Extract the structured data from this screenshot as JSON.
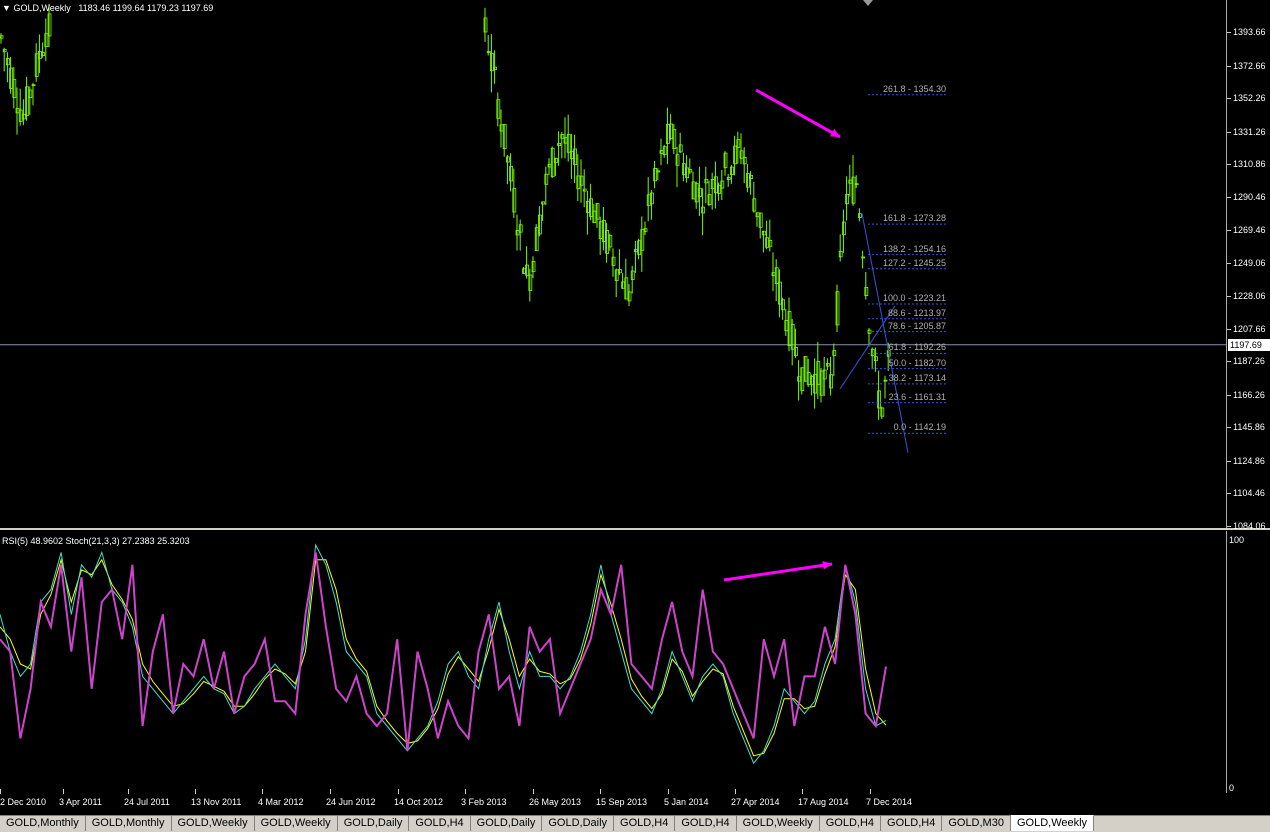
{
  "window": {
    "symbol_header": "GOLD,Weekly",
    "ohlc": "1183.46 1199.64 1179.23 1197.69",
    "current_price": "1197.69",
    "indicator_header": "RSI(5) 48.9602 Stoch(21,3,3) 27.2383 25.3203"
  },
  "price_axis": [
    "1393.66",
    "1372.66",
    "1352.26",
    "1331.26",
    "1310.86",
    "1290.46",
    "1269.46",
    "1249.06",
    "1228.06",
    "1207.66",
    "1187.26",
    "1166.26",
    "1145.86",
    "1124.86",
    "1104.46",
    "1084.06"
  ],
  "indicator_axis": {
    "max": "100",
    "min": "0"
  },
  "date_axis": [
    "2 Dec 2010",
    "3 Apr 2011",
    "24 Jul 2011",
    "13 Nov 2011",
    "4 Mar 2012",
    "24 Jun 2012",
    "14 Oct 2012",
    "3 Feb 2013",
    "26 May 2013",
    "15 Sep 2013",
    "5 Jan 2014",
    "27 Apr 2014",
    "17 Aug 2014",
    "7 Dec 2014"
  ],
  "fib_levels": [
    "261.8 - 1354.30",
    "161.8 - 1273.28",
    "138.2 - 1254.16",
    "127.2 - 1245.25",
    "100.0 - 1223.21",
    "88.6 - 1213.97",
    "78.6 - 1205.87",
    "61.8 - 1192.26",
    "50.0 - 1182.70",
    "38.2 - 1173.14",
    "23.6 - 1161.31",
    "0.0 - 1142.19"
  ],
  "tabs": [
    {
      "label": "GOLD,Monthly",
      "active": false
    },
    {
      "label": "GOLD,Monthly",
      "active": false
    },
    {
      "label": "GOLD,Weekly",
      "active": false
    },
    {
      "label": "GOLD,Weekly",
      "active": false
    },
    {
      "label": "GOLD,Daily",
      "active": false
    },
    {
      "label": "GOLD,H4",
      "active": false
    },
    {
      "label": "GOLD,Daily",
      "active": false
    },
    {
      "label": "GOLD,Daily",
      "active": false
    },
    {
      "label": "GOLD,H4",
      "active": false
    },
    {
      "label": "GOLD,H4",
      "active": false
    },
    {
      "label": "GOLD,Weekly",
      "active": false
    },
    {
      "label": "GOLD,H4",
      "active": false
    },
    {
      "label": "GOLD,H4",
      "active": false
    },
    {
      "label": "GOLD,M30",
      "active": false
    },
    {
      "label": "GOLD,Weekly",
      "active": true
    }
  ],
  "colors": {
    "background": "#000000",
    "candles": "#7CFC00",
    "rsi": "#FFFF00",
    "stoch_main": "#40E0D0",
    "stoch_signal": "#CC44CC",
    "arrow": "#FF00FF",
    "trendline": "#3355DD",
    "grid_price_line": "#8890B0"
  },
  "chart_data": [
    {
      "type": "candlestick",
      "title": "GOLD,Weekly",
      "y_range": [
        1084.06,
        1393.66
      ],
      "close_path": [
        [
          "2 Dec 2010",
          1390
        ],
        [
          "3 Apr 2011",
          1360
        ],
        [
          "3 Apr 2011",
          1400
        ],
        [
          "26 May 2013",
          1235
        ],
        [
          "26 May 2013",
          1320
        ],
        [
          "15 Sep 2013",
          1325
        ],
        [
          "15 Sep 2013",
          1250
        ],
        [
          "5 Jan 2014",
          1230
        ],
        [
          "5 Jan 2014",
          1330
        ],
        [
          "27 Apr 2014",
          1290
        ],
        [
          "27 Apr 2014",
          1320
        ],
        [
          "17 Aug 2014",
          1250
        ],
        [
          "17 Aug 2014",
          1180
        ],
        [
          "7 Dec 2014",
          1175
        ],
        [
          "7 Dec 2014",
          1210
        ],
        [
          "7 Dec 2014",
          1295
        ],
        [
          "7 Dec 2014",
          1200
        ],
        [
          "7 Dec 2014",
          1155
        ],
        [
          "7 Dec 2014",
          1197.69
        ]
      ]
    },
    {
      "type": "line",
      "title": "RSI(5) 48.9602 Stoch(21,3,3) 27.2383 25.3203",
      "y_range": [
        0,
        100
      ],
      "series": [
        {
          "name": "RSI(5)",
          "values": [
            60,
            55,
            20,
            40,
            75,
            65,
            90,
            55,
            85,
            40,
            75,
            80,
            60,
            90,
            25,
            55,
            70,
            30,
            50,
            45,
            60,
            40,
            55,
            30,
            45,
            50,
            60,
            35,
            35,
            30,
            70,
            95,
            65,
            40,
            35,
            45,
            30,
            25,
            30,
            60,
            15,
            55,
            40,
            20,
            35,
            25,
            20,
            55,
            70,
            40,
            45,
            25,
            65,
            55,
            60,
            30,
            40,
            50,
            60,
            80,
            70,
            90,
            50,
            45,
            40,
            60,
            75,
            55,
            45,
            80,
            55,
            50,
            40,
            30,
            20,
            60,
            45,
            60,
            25,
            45,
            45,
            65,
            50,
            90,
            70,
            30,
            25,
            48.96
          ]
        },
        {
          "name": "Stoch(21,3,3)",
          "values": [
            70,
            55,
            45,
            50,
            75,
            80,
            95,
            70,
            90,
            85,
            95,
            80,
            75,
            65,
            45,
            40,
            35,
            30,
            35,
            40,
            45,
            40,
            38,
            30,
            33,
            40,
            45,
            50,
            45,
            40,
            60,
            98,
            90,
            75,
            55,
            50,
            45,
            30,
            25,
            20,
            15,
            20,
            25,
            35,
            50,
            55,
            45,
            40,
            60,
            75,
            55,
            40,
            55,
            45,
            45,
            40,
            45,
            55,
            70,
            90,
            70,
            55,
            40,
            35,
            30,
            40,
            55,
            45,
            35,
            45,
            50,
            45,
            30,
            20,
            10,
            15,
            25,
            40,
            35,
            30,
            35,
            50,
            60,
            90,
            75,
            40,
            25,
            27.24
          ]
        },
        {
          "name": "Stoch signal",
          "values": [
            65,
            60,
            50,
            48,
            70,
            78,
            92,
            75,
            88,
            86,
            92,
            82,
            76,
            68,
            50,
            43,
            38,
            33,
            34,
            38,
            43,
            41,
            39,
            33,
            33,
            38,
            44,
            48,
            46,
            42,
            55,
            92,
            92,
            80,
            60,
            52,
            47,
            33,
            27,
            22,
            18,
            19,
            24,
            32,
            46,
            53,
            48,
            43,
            56,
            72,
            60,
            45,
            52,
            47,
            46,
            42,
            44,
            52,
            66,
            86,
            74,
            60,
            44,
            37,
            32,
            38,
            52,
            47,
            37,
            43,
            48,
            46,
            33,
            23,
            13,
            14,
            22,
            36,
            36,
            32,
            33,
            46,
            57,
            86,
            80,
            48,
            30,
            25.32
          ]
        }
      ]
    }
  ]
}
